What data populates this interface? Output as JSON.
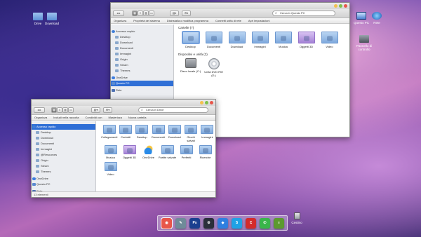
{
  "colors": {
    "selection": "#2f6fd6",
    "folder": "#7ea9dd",
    "sidebar_bg": "#ebedf1",
    "dock_chrome": "#e8564a",
    "dock_ps": "#1a3f8f"
  },
  "desktop": {
    "icons": [
      {
        "label": "Drive",
        "icon": "folder-icon"
      },
      {
        "label": "Download",
        "icon": "folder-icon"
      },
      {
        "label": "Questo PC",
        "icon": "computer-icon"
      },
      {
        "label": "Rete",
        "icon": "network-icon"
      },
      {
        "label": "Pannello di controllo",
        "icon": "control-panel-icon"
      }
    ]
  },
  "window_pc": {
    "search_placeholder": "Cerca in Questo PC",
    "commands": [
      "Organizza",
      "Proprietà del sistema",
      "Disinstalla o modifica programma",
      "Connetti unità di rete",
      "Apri impostazioni"
    ],
    "sidebar": {
      "items": [
        {
          "label": "Accesso rapido",
          "icon": "star-icon"
        },
        {
          "label": "Desktop",
          "icon": "folder-icon"
        },
        {
          "label": "Download",
          "icon": "folder-icon"
        },
        {
          "label": "Documenti",
          "icon": "folder-icon"
        },
        {
          "label": "Immagini",
          "icon": "folder-icon"
        },
        {
          "label": "Origin",
          "icon": "folder-icon"
        },
        {
          "label": "Steam",
          "icon": "folder-icon"
        },
        {
          "label": "Themes",
          "icon": "folder-icon"
        },
        {
          "label": "OneDrive",
          "icon": "cloud-icon"
        },
        {
          "label": "Questo PC",
          "icon": "computer-icon"
        },
        {
          "label": "Rete",
          "icon": "network-icon"
        }
      ]
    },
    "folders_title": "Cartelle (7)",
    "folders": [
      "Desktop",
      "Documenti",
      "Download",
      "Immagini",
      "Musica",
      "Oggetti 3D",
      "Video"
    ],
    "devices_title": "Dispositivi e unità (2)",
    "devices": [
      "Disco locale (C:)",
      "Unità DVD RW (E:)"
    ]
  },
  "window_drive": {
    "search_placeholder": "Cerca in Drive",
    "commands": [
      "Organizza",
      "Includi nella raccolta",
      "Condividi con",
      "Masterizza",
      "Nuova cartella"
    ],
    "sidebar": {
      "items": [
        {
          "label": "Accesso rapido",
          "icon": "star-icon"
        },
        {
          "label": "Desktop",
          "icon": "folder-icon"
        },
        {
          "label": "Download",
          "icon": "folder-icon"
        },
        {
          "label": "Documenti",
          "icon": "folder-icon"
        },
        {
          "label": "Immagini",
          "icon": "folder-icon"
        },
        {
          "label": "@Resources",
          "icon": "folder-icon"
        },
        {
          "label": "Origin",
          "icon": "folder-icon"
        },
        {
          "label": "Steam",
          "icon": "folder-icon"
        },
        {
          "label": "Themes",
          "icon": "folder-icon"
        },
        {
          "label": "OneDrive",
          "icon": "cloud-icon"
        },
        {
          "label": "Questo PC",
          "icon": "computer-icon"
        },
        {
          "label": "Rete",
          "icon": "network-icon"
        }
      ]
    },
    "items_row1": [
      "Collegamenti",
      "Contatti",
      "Desktop",
      "Documenti",
      "Download",
      "Giochi salvati",
      "Immagini"
    ],
    "items_row2": [
      "Musica",
      "Oggetti 3D",
      "OneDrive",
      "Partite salvate",
      "Preferiti",
      "Ricerche"
    ],
    "items_row3": [
      "Video"
    ],
    "status": "13 elementi"
  },
  "dock": {
    "apps": [
      {
        "name": "chrome",
        "glyph": "◉",
        "color": "#e8564a"
      },
      {
        "name": "notes",
        "glyph": "✎",
        "color": "#6f8b99"
      },
      {
        "name": "photoshop",
        "glyph": "Ps",
        "color": "#1a3f8f"
      },
      {
        "name": "steam",
        "glyph": "⚙",
        "color": "#2a2f3a"
      },
      {
        "name": "dropbox",
        "glyph": "◆",
        "color": "#2f7fe0"
      },
      {
        "name": "skype",
        "glyph": "S",
        "color": "#1fa2e6"
      },
      {
        "name": "ccleaner",
        "glyph": "C",
        "color": "#d42b2b"
      },
      {
        "name": "whatsapp",
        "glyph": "✆",
        "color": "#39b54a"
      },
      {
        "name": "notepad",
        "glyph": "≡",
        "color": "#5c9a2f"
      }
    ],
    "trash_label": "Cestino"
  }
}
